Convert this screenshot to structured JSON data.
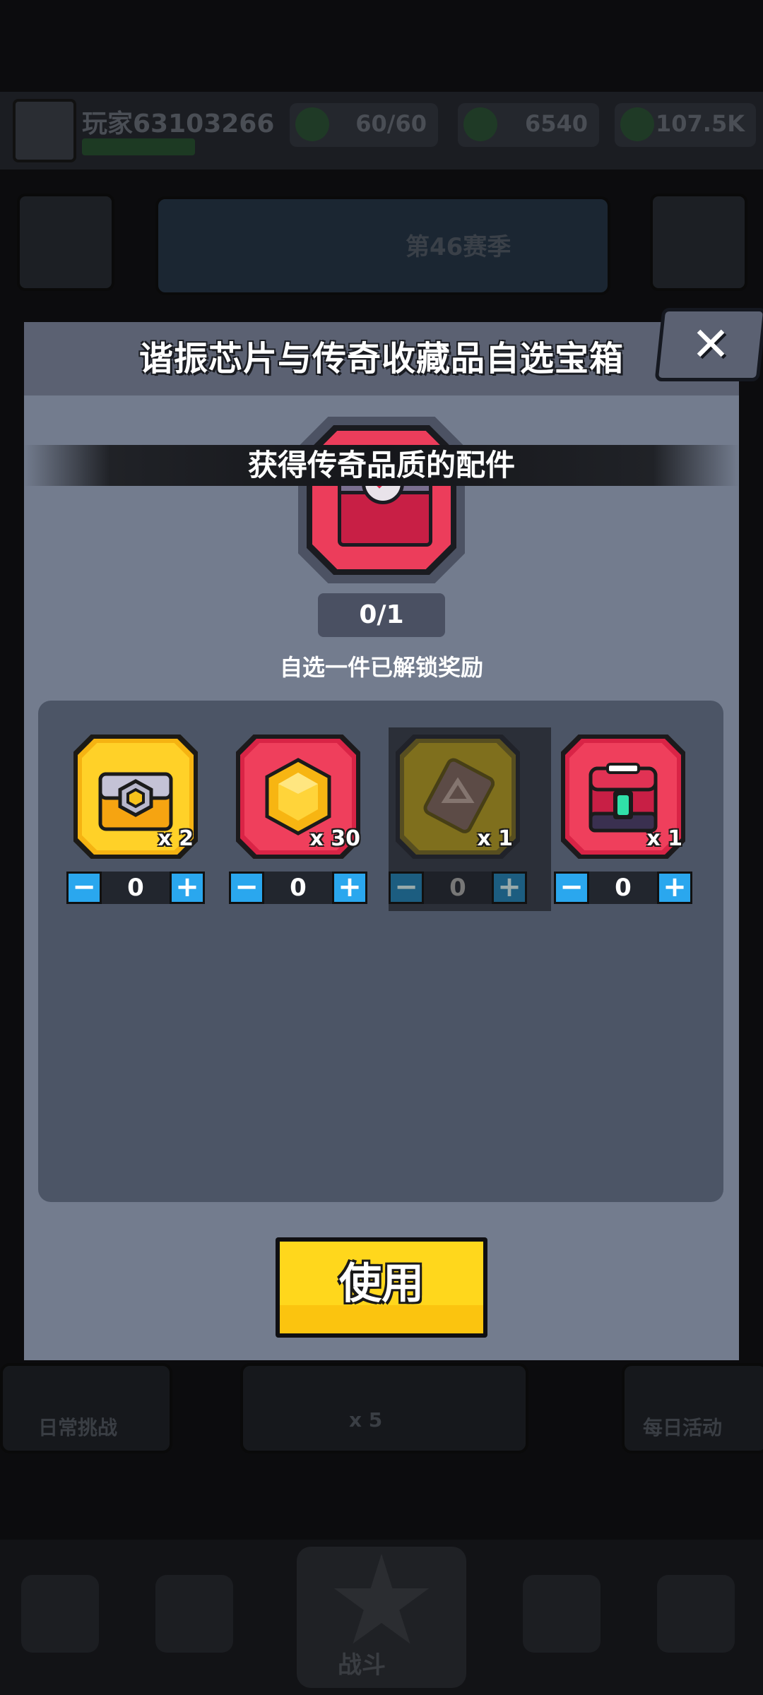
{
  "background": {
    "player_name": "玩家63103266",
    "resources": [
      {
        "icon": "energy-icon",
        "value": "60/60"
      },
      {
        "icon": "cash-icon",
        "value": "6540"
      },
      {
        "icon": "gem-icon",
        "value": "107.5K"
      }
    ],
    "banner_text": "第46赛季",
    "bottom_left_label": "日常挑战",
    "bottom_center_label": "x 5",
    "bottom_right_label": "每日活动",
    "nav_center_label": "战斗"
  },
  "dialog": {
    "title": "谐振芯片与传奇收藏品自选宝箱",
    "close_label": "✕",
    "reward_banner": "获得传奇品质的配件",
    "counter": "0/1",
    "hint": "自选一件已解锁奖励",
    "use_button": "使用"
  },
  "items": [
    {
      "name": "gold-chest",
      "icon": "chest-icon",
      "quantity": "x 2",
      "count": "0",
      "enabled": true,
      "color": "#f7c21b"
    },
    {
      "name": "yellow-gem",
      "icon": "gem-icon",
      "quantity": "x 30",
      "count": "0",
      "enabled": true,
      "color": "#ef3f5c"
    },
    {
      "name": "resonance-chip",
      "icon": "chip-icon",
      "quantity": "x 1",
      "count": "0",
      "enabled": false,
      "color": "#b8930f"
    },
    {
      "name": "red-chest",
      "icon": "chest-icon",
      "quantity": "x 1",
      "count": "0",
      "enabled": true,
      "color": "#ef3f5c"
    }
  ],
  "stepper": {
    "minus": "−",
    "plus": "+"
  }
}
